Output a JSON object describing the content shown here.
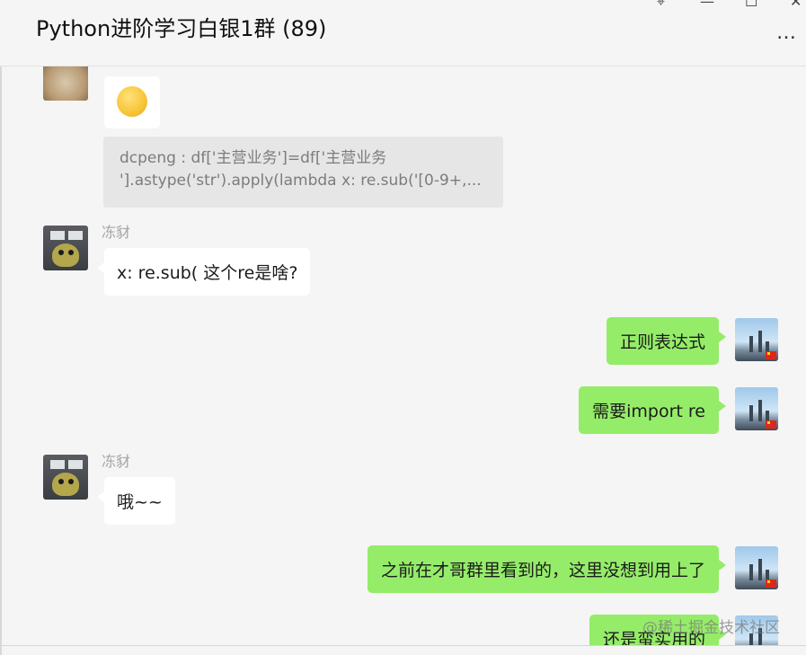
{
  "window": {
    "title": "Python进阶学习白银1群 (89)",
    "controls": {
      "pin": "⌖",
      "minimize": "—",
      "maximize": "☐",
      "close": "✕"
    },
    "more": "…"
  },
  "messages": [
    {
      "sender": "",
      "type": "emoji"
    },
    {
      "type": "quote",
      "line1": "dcpeng : df['主营业务']=df['主营业务",
      "line2": "'].astype('str').apply(lambda x: re.sub('[0-9+,..."
    },
    {
      "sender": "冻豺",
      "text": "x: re.sub( 这个re是啥?"
    },
    {
      "sender": "me",
      "text": "正则表达式"
    },
    {
      "sender": "me",
      "text": "需要import re"
    },
    {
      "sender": "冻豺",
      "text": "哦~~"
    },
    {
      "sender": "me",
      "text": "之前在才哥群里看到的，这里没想到用上了"
    },
    {
      "sender": "me",
      "text": "还是蛮实用的"
    }
  ],
  "watermark": "@稀土掘金技术社区",
  "colors": {
    "outgoing": "#95ec69",
    "incoming": "#ffffff",
    "background": "#f5f5f5"
  }
}
